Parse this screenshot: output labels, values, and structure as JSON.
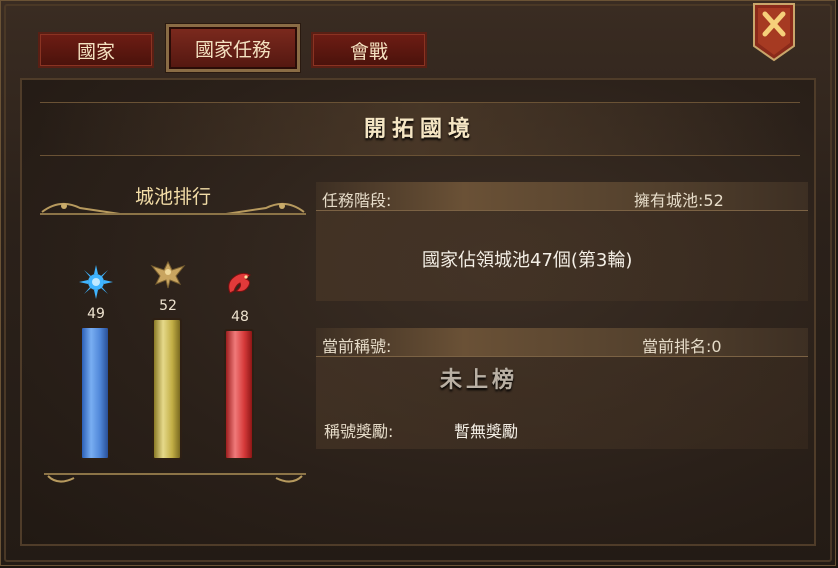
{
  "tabs": [
    {
      "label": "國家",
      "active": false
    },
    {
      "label": "國家任務",
      "active": true
    },
    {
      "label": "會戰",
      "active": false
    }
  ],
  "close_icon": "close-x-icon",
  "section_title": "開拓國境",
  "ranking": {
    "title": "城池排行",
    "entries": [
      {
        "icon": "blue-sun-emblem-icon",
        "value": "49",
        "color": "#4f86d8"
      },
      {
        "icon": "gold-eagle-emblem-icon",
        "value": "52",
        "color": "#c2ae45"
      },
      {
        "icon": "red-dragon-emblem-icon",
        "value": "48",
        "color": "#d63a3a"
      }
    ],
    "max_value": 52
  },
  "task": {
    "stage_label": "任務階段:",
    "owned_label": "擁有城池:52",
    "description": "國家佔領城池47個(第3輪)"
  },
  "title_info": {
    "current_title_label": "當前稱號:",
    "current_rank_label": "當前排名:0",
    "current_title_value": "未上榜",
    "reward_label": "稱號獎勵:",
    "reward_value": "暫無獎勵"
  }
}
